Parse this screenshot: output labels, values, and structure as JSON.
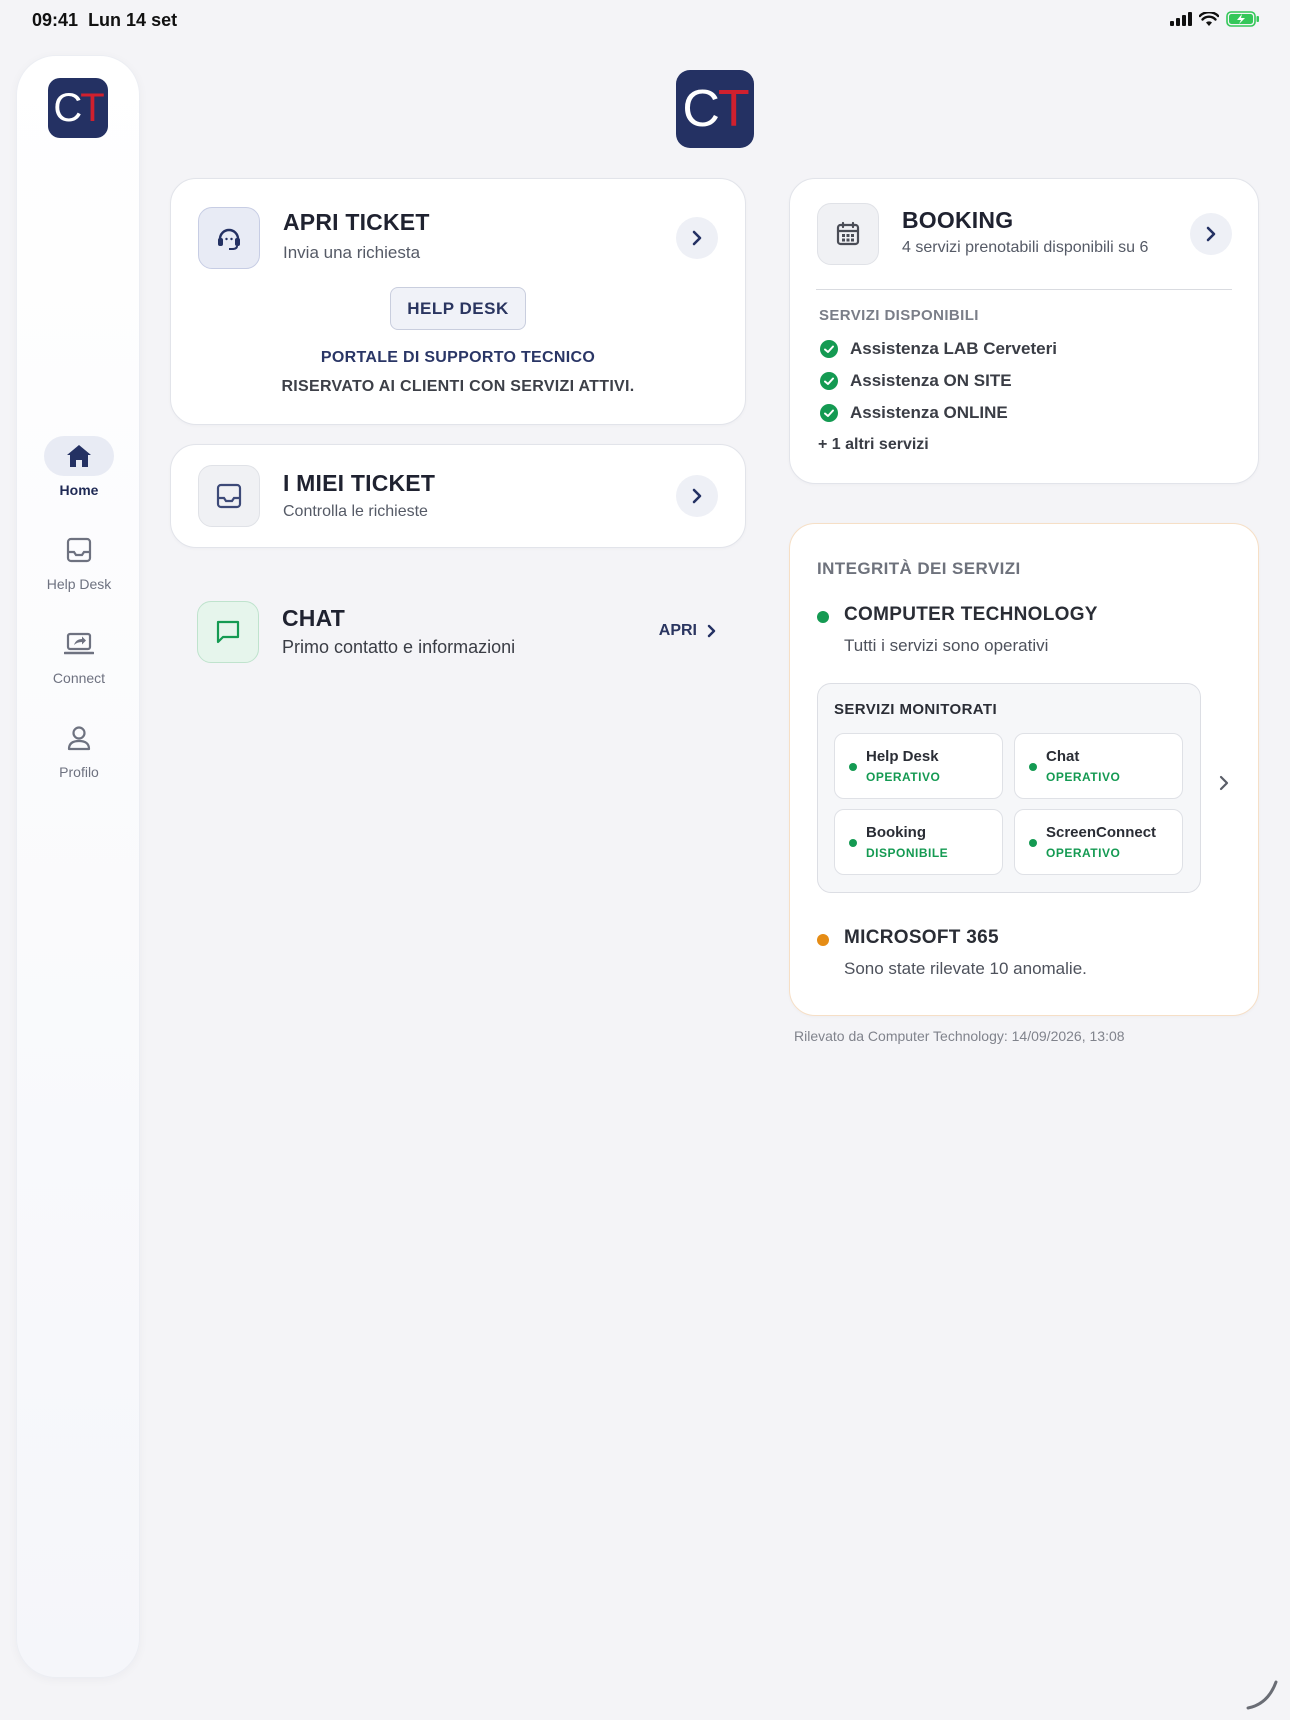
{
  "status_bar": {
    "time": "09:41",
    "date": "Lun 14 set"
  },
  "logo": {
    "c": "C",
    "t": "T"
  },
  "sidebar": {
    "items": [
      {
        "label": "Home",
        "icon": "home-icon",
        "active": true
      },
      {
        "label": "Help Desk",
        "icon": "inbox-icon",
        "active": false
      },
      {
        "label": "Connect",
        "icon": "laptop-share-icon",
        "active": false
      },
      {
        "label": "Profilo",
        "icon": "person-icon",
        "active": false
      }
    ]
  },
  "apri_ticket": {
    "title": "APRI TICKET",
    "subtitle": "Invia una richiesta",
    "button": "HELP DESK",
    "portal_line1": "PORTALE DI SUPPORTO TECNICO",
    "portal_line2": "RISERVATO AI CLIENTI CON SERVIZI ATTIVI."
  },
  "miei_ticket": {
    "title": "I MIEI TICKET",
    "subtitle": "Controlla le richieste"
  },
  "chat": {
    "title": "CHAT",
    "subtitle": "Primo contatto e informazioni",
    "action": "APRI"
  },
  "booking": {
    "title": "BOOKING",
    "subtitle": "4 servizi prenotabili disponibili su 6",
    "section_label": "SERVIZI DISPONIBILI",
    "services": [
      "Assistenza LAB Cerveteri",
      "Assistenza ON SITE",
      "Assistenza ONLINE"
    ],
    "more": "+ 1 altri servizi"
  },
  "integrity": {
    "title": "INTEGRITÀ DEI SERVIZI",
    "providers": [
      {
        "name": "COMPUTER TECHNOLOGY",
        "desc": "Tutti i servizi sono operativi",
        "color": "#149a52"
      },
      {
        "name": "MICROSOFT 365",
        "desc": "Sono state rilevate 10 anomalie.",
        "color": "#e58c15"
      }
    ],
    "monitored": {
      "title": "SERVIZI MONITORATI",
      "items": [
        {
          "name": "Help Desk",
          "status": "OPERATIVO"
        },
        {
          "name": "Chat",
          "status": "OPERATIVO"
        },
        {
          "name": "Booking",
          "status": "DISPONIBILE"
        },
        {
          "name": "ScreenConnect",
          "status": "OPERATIVO"
        }
      ]
    },
    "detected": "Rilevato da Computer Technology: 14/09/2026, 13:08"
  },
  "colors": {
    "brand": "#243163",
    "accent_red": "#d0202e",
    "ok": "#149a52",
    "warn": "#e58c15"
  }
}
